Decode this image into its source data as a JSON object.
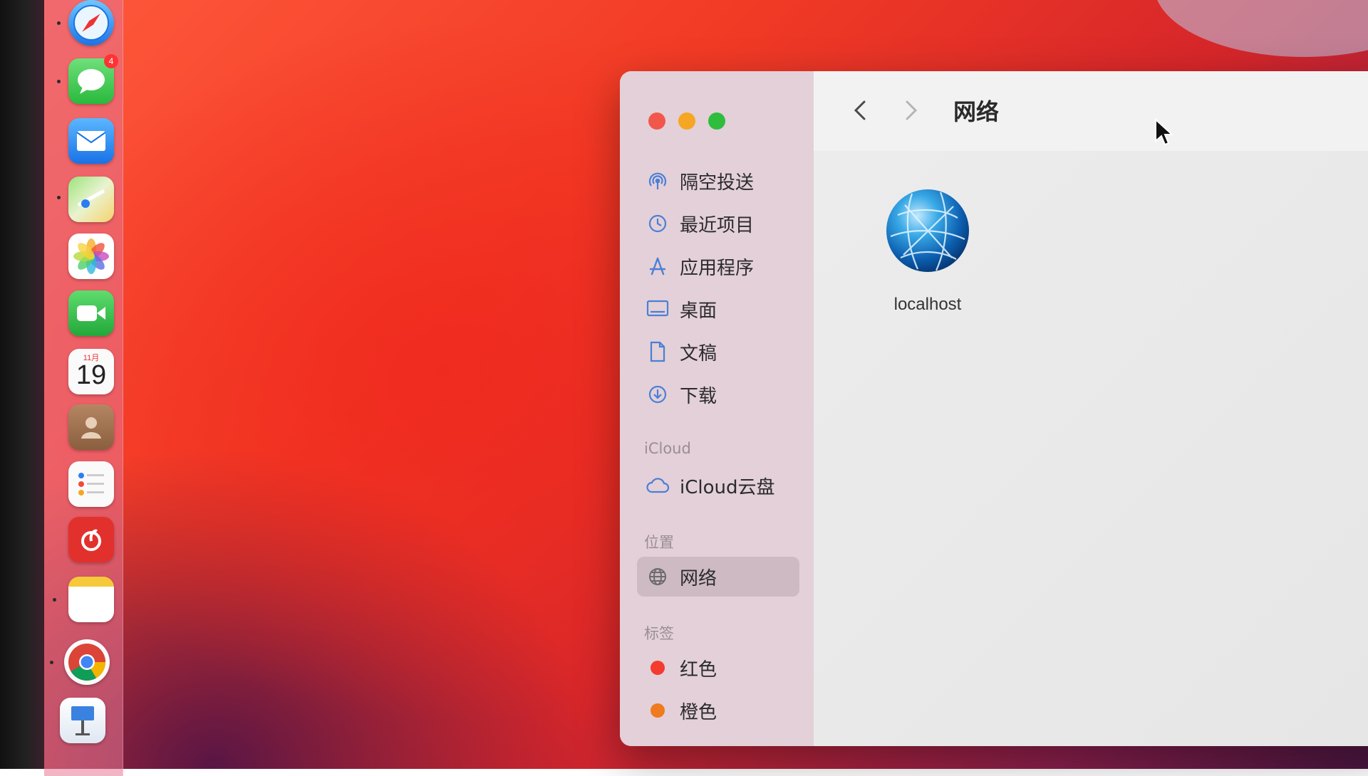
{
  "dock": {
    "calendar": {
      "month": "11月",
      "day": "19"
    },
    "messages_badge": "4"
  },
  "window": {
    "title": "网络",
    "sidebar": {
      "favorites": [
        {
          "label": "隔空投送",
          "icon": "airdrop-icon"
        },
        {
          "label": "最近项目",
          "icon": "clock-icon"
        },
        {
          "label": "应用程序",
          "icon": "applications-icon"
        },
        {
          "label": "桌面",
          "icon": "desktop-icon"
        },
        {
          "label": "文稿",
          "icon": "document-icon"
        },
        {
          "label": "下载",
          "icon": "download-icon"
        }
      ],
      "icloud_header": "iCloud",
      "icloud_items": [
        {
          "label": "iCloud云盘",
          "icon": "cloud-icon"
        }
      ],
      "locations_header": "位置",
      "location_items": [
        {
          "label": "网络",
          "icon": "network-icon",
          "selected": true
        }
      ],
      "tags_header": "标签",
      "tags": [
        {
          "label": "红色",
          "color": "#f43b2f"
        },
        {
          "label": "橙色",
          "color": "#f07a1f"
        }
      ]
    },
    "content": {
      "items": [
        {
          "label": "localhost",
          "icon": "network-globe-icon"
        }
      ]
    }
  },
  "colors": {
    "close": "#f2574b",
    "minimize": "#f5a623",
    "zoom": "#2ebd3c",
    "accent_icon": "#4b7fd6"
  }
}
